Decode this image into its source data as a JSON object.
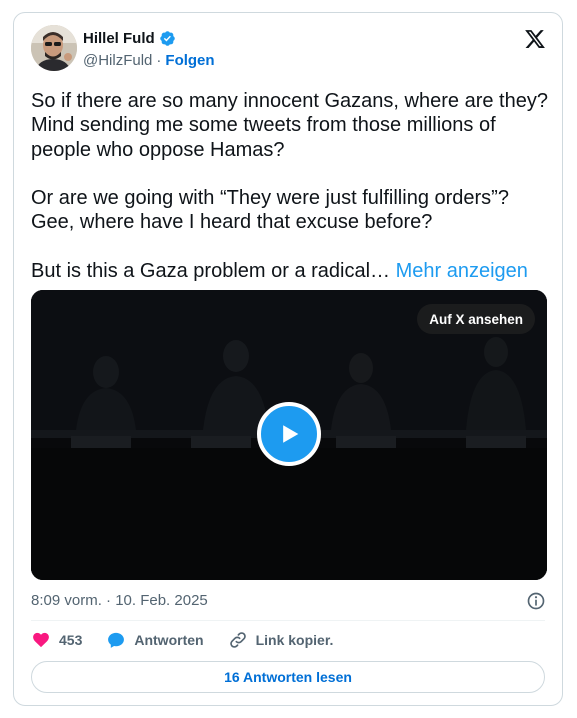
{
  "author": {
    "name": "Hillel Fuld",
    "handle": "@HilzFuld",
    "separator": "·",
    "follow_label": "Folgen"
  },
  "tweet": {
    "paragraphs": [
      [
        "So if there are so many innocent Gazans, where are they?",
        "Mind sending me some tweets from those millions of",
        "people who oppose Hamas?"
      ],
      [
        "Or are we going with “They were just fulfilling orders”?",
        "Gee, where have I heard that excuse before?"
      ]
    ],
    "truncated_line": "But is this a Gaza problem or a radical…",
    "more_label": "Mehr anzeigen"
  },
  "video": {
    "watch_label": "Auf X ansehen"
  },
  "timestamp": "8:09 vorm. · 10. Feb. 2025",
  "actions": {
    "like_count": "453",
    "reply_label": "Antworten",
    "copy_link_label": "Link kopier."
  },
  "read_replies_label": "16 Antworten lesen",
  "colors": {
    "accent": "#1d9bf0",
    "link": "#006fd6",
    "like": "#f91880",
    "muted": "#536471"
  }
}
